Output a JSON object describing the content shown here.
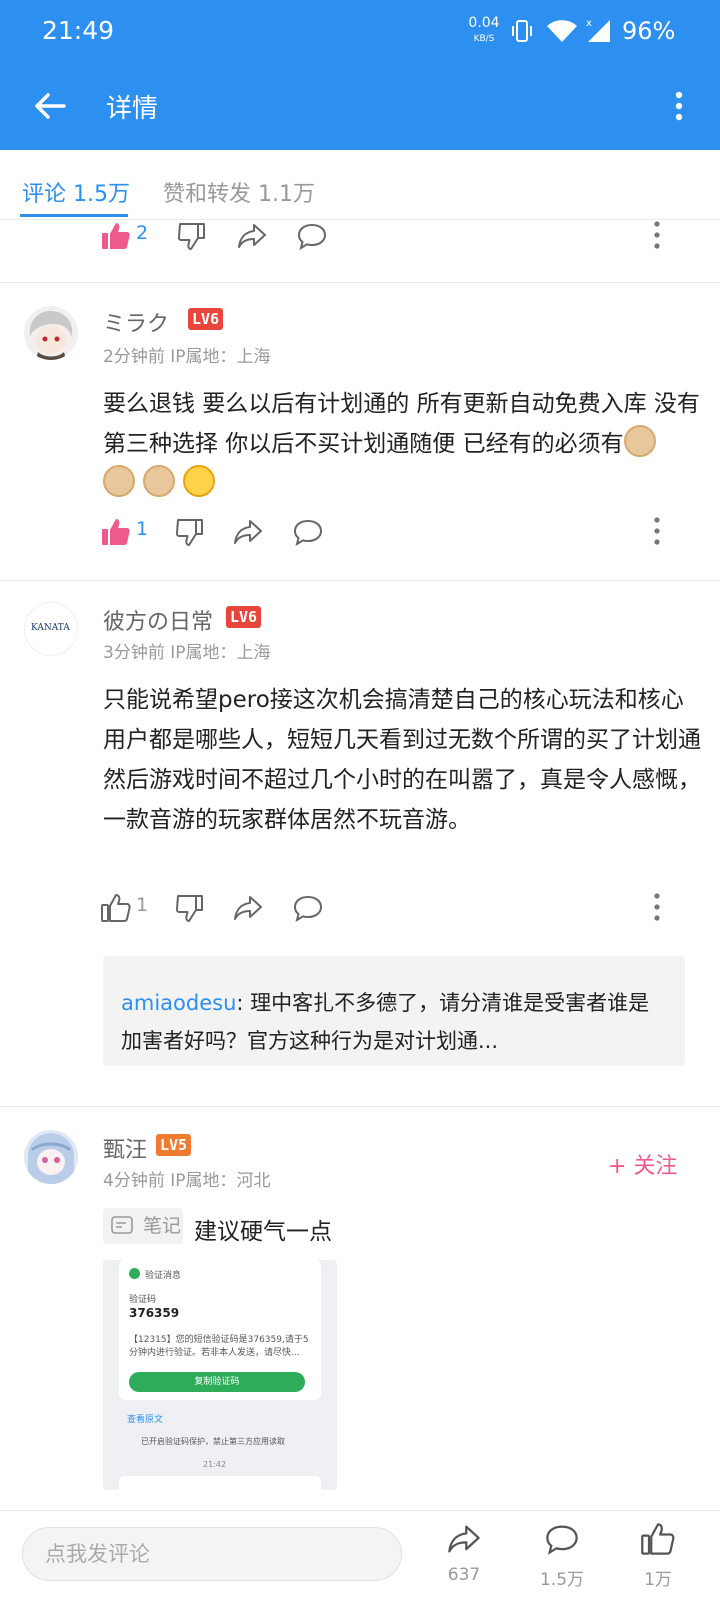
{
  "status_bar": {
    "time": "21:49",
    "net_speed": "0.04",
    "net_unit": "KB/S",
    "battery": "96%"
  },
  "app_bar": {
    "title": "详情"
  },
  "tabs": [
    {
      "label": "评论 1.5万"
    },
    {
      "label": "赞和转发 1.1万"
    }
  ],
  "comments": [
    {
      "like_count": "2"
    },
    {
      "user": "ミラク",
      "level": "LV6",
      "time_location": "2分钟前  IP属地：上海",
      "text": "要么退钱 要么以后有计划通的 所有更新自动免费入库 没有第三种选择 你以后不买计划通随便 已经有的必须有",
      "like_count": "1"
    },
    {
      "user": "彼方の日常",
      "level": "LV6",
      "avatar_text": "KANATA",
      "time_location": "3分钟前  IP属地：上海",
      "text": "只能说希望pero接这次机会搞清楚自己的核心玩法和核心用户都是哪些人，短短几天看到过无数个所谓的买了计划通然后游戏时间不超过几个小时的在叫嚣了，真是令人感慨，一款音游的玩家群体居然不玩音游。",
      "like_count": "1",
      "reply": {
        "user": "amiaodesu",
        "text": "理中客扎不多德了，请分清谁是受害者谁是加害者好吗？官方这种行为是对计划通..."
      }
    },
    {
      "user": "甄汪",
      "level": "LV5",
      "time_location": "4分钟前  IP属地：河北",
      "follow_label": "+ 关注",
      "note_tag": "笔记",
      "text": "建议硬气一点",
      "screenshot": {
        "header": "验证消息",
        "code_label": "验证码",
        "code": "376359",
        "message": "【12315】您的短信验证码是376359,请于5分钟内进行验证。若非本人发送，请尽快...",
        "copy_button": "复制验证码",
        "view_original": "查看原文",
        "protection": "已开启验证码保护，禁止第三方应用读取",
        "time": "21:42"
      }
    }
  ],
  "bottom_bar": {
    "input_placeholder": "点我发评论",
    "share_count": "637",
    "comment_count": "1.5万",
    "like_count": "1万"
  },
  "colors": {
    "primary": "#2d8ff0",
    "like_pink": "#ee5a8c",
    "lv6": "#e8453c",
    "lv5": "#f07b2f"
  }
}
